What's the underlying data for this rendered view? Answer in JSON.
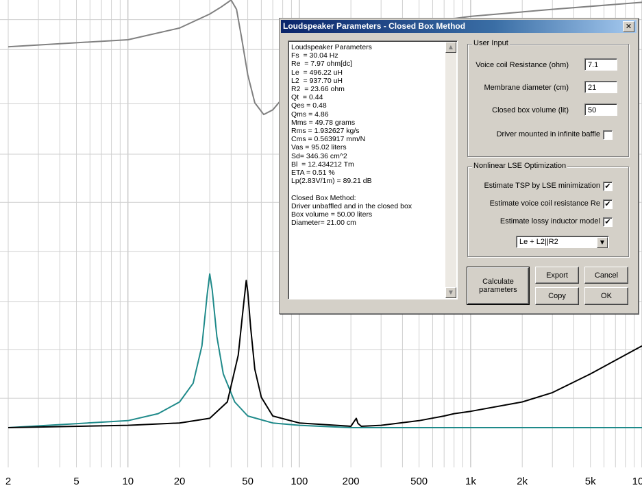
{
  "chart_data": {
    "type": "line",
    "x_scale": "log",
    "xlim": [
      2,
      10000
    ],
    "x_ticks": [
      2,
      5,
      10,
      20,
      50,
      100,
      200,
      500,
      1000,
      2000,
      5000,
      10000
    ],
    "x_tick_labels": [
      "2",
      "5",
      "10",
      "20",
      "50",
      "100",
      "200",
      "500",
      "1k",
      "2k",
      "5k",
      "10"
    ],
    "grid": true,
    "series": [
      {
        "color": "#808080",
        "x": [
          2,
          10,
          20,
          30,
          35,
          40,
          43,
          46,
          50,
          55,
          62,
          70,
          80,
          100,
          150,
          300,
          1000,
          3000,
          10000
        ],
        "y": [
          0.1,
          0.085,
          0.06,
          0.03,
          0.015,
          0.0,
          0.02,
          0.08,
          0.16,
          0.22,
          0.245,
          0.235,
          0.21,
          0.16,
          0.1,
          0.06,
          0.035,
          0.02,
          0.005
        ]
      },
      {
        "color": "#1f8a8a",
        "x": [
          2,
          10,
          15,
          20,
          24,
          27,
          29,
          30,
          31,
          33,
          36,
          42,
          50,
          70,
          100,
          200,
          10000
        ],
        "y": [
          0.915,
          0.9,
          0.885,
          0.86,
          0.82,
          0.74,
          0.63,
          0.586,
          0.62,
          0.72,
          0.8,
          0.86,
          0.89,
          0.905,
          0.91,
          0.915,
          0.915
        ]
      },
      {
        "color": "#000000",
        "x": [
          2,
          10,
          20,
          30,
          38,
          44,
          47,
          49,
          50,
          52,
          55,
          60,
          70,
          100,
          200,
          215,
          220,
          230,
          300,
          500,
          700,
          800,
          1000,
          2000,
          3000,
          5000,
          10000
        ],
        "y": [
          0.915,
          0.91,
          0.905,
          0.895,
          0.86,
          0.76,
          0.66,
          0.6,
          0.624,
          0.7,
          0.79,
          0.85,
          0.89,
          0.905,
          0.912,
          0.895,
          0.906,
          0.912,
          0.91,
          0.9,
          0.89,
          0.885,
          0.88,
          0.86,
          0.84,
          0.8,
          0.74
        ]
      }
    ]
  },
  "dialog": {
    "title": "Loudspeaker Parameters - Closed Box Method",
    "close_glyph": "✕",
    "results_text": "Loudspeaker Parameters\nFs  = 30.04 Hz\nRe  = 7.97 ohm[dc]\nLe  = 496.22 uH\nL2  = 937.70 uH\nR2  = 23.66 ohm\nQt  = 0.44\nQes = 0.48\nQms = 4.86\nMms = 49.78 grams\nRms = 1.932627 kg/s\nCms = 0.563917 mm/N\nVas = 95.02 liters\nSd= 346.36 cm^2\nBl  = 12.434212 Tm\nETA = 0.51 %\nLp(2.83V/1m) = 89.21 dB\n\nClosed Box Method:\nDriver unbaffled and in the closed box\nBox volume = 50.00 liters\nDiameter= 21.00 cm",
    "user_input": {
      "title": "User Input",
      "voice_coil_label": "Voice coil Resistance (ohm)",
      "voice_coil_value": "7.1",
      "diameter_label": "Membrane diameter (cm)",
      "diameter_value": "21",
      "box_volume_label": "Closed box volume (lit)",
      "box_volume_value": "50",
      "infinite_baffle_label": "Driver mounted in infinite baffle",
      "infinite_baffle_checked": false
    },
    "lse": {
      "title": "Nonlinear LSE Optimization",
      "tsp_label": "Estimate TSP by LSE minimization",
      "re_label": "Estimate voice coil resistance Re",
      "inductor_label": "Estimate lossy inductor model",
      "check_glyph": "✔",
      "model_selected": "Le + L2||R2"
    },
    "buttons": {
      "calculate": "Calculate parameters",
      "export": "Export",
      "cancel": "Cancel",
      "copy": "Copy",
      "ok": "OK"
    }
  }
}
